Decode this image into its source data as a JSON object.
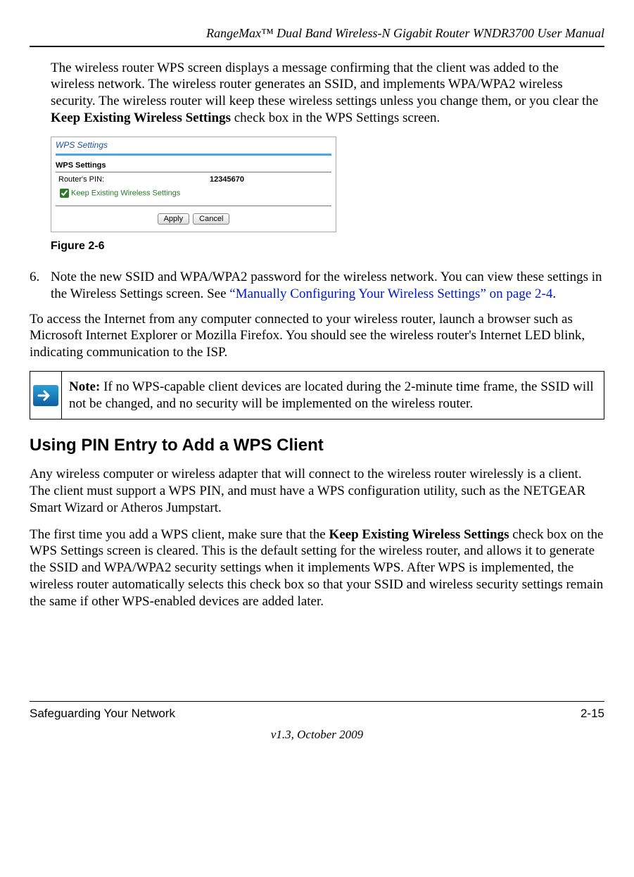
{
  "header": {
    "title": "RangeMax™ Dual Band Wireless-N Gigabit Router WNDR3700 User Manual"
  },
  "para1": {
    "pre": "The wireless router WPS screen displays a message confirming that the client was added to the wireless network. The wireless router generates an SSID, and implements WPA/WPA2 wireless security. The wireless router will keep these wireless settings unless you change them, or you clear the ",
    "bold": "Keep Existing Wireless Settings",
    "post": " check box in the WPS Settings screen."
  },
  "figure": {
    "title": "WPS Settings",
    "section_label": "WPS Settings",
    "pin_label": "Router's PIN:",
    "pin_value": "12345670",
    "checkbox_label": "Keep Existing Wireless Settings",
    "apply_label": "Apply",
    "cancel_label": "Cancel",
    "caption": "Figure 2-6"
  },
  "step6": {
    "num": "6.",
    "text_pre": "Note the new SSID and WPA/WPA2 password for the wireless network. You can view these settings in the Wireless Settings screen. See ",
    "link": "“Manually Configuring Your Wireless Settings” on page 2-4",
    "post": "."
  },
  "para_access": "To access the Internet from any computer connected to your wireless router, launch a browser such as Microsoft Internet Explorer or Mozilla Firefox. You should see the wireless router's Internet LED blink, indicating communication to the ISP.",
  "note": {
    "label": "Note:",
    "text": " If no WPS-capable client devices are located during the 2-minute time frame, the SSID will not be changed, and no security will be implemented on the wireless router."
  },
  "section_heading": "Using PIN Entry to Add a WPS Client",
  "para_pin1": "Any wireless computer or wireless adapter that will connect to the wireless router wirelessly is a client. The client must support a WPS PIN, and must have a WPS configuration utility, such as the NETGEAR Smart Wizard or Atheros Jumpstart.",
  "para_pin2": {
    "pre": "The first time you add a WPS client, make sure that the ",
    "bold": "Keep Existing Wireless Settings",
    "post": " check box on the WPS Settings screen is cleared. This is the default setting for the wireless router, and allows it to generate the SSID and WPA/WPA2 security settings when it implements WPS. After WPS is implemented, the wireless router automatically selects this check box so that your SSID and wireless security settings remain the same if other WPS-enabled devices are added later."
  },
  "footer": {
    "left": "Safeguarding Your Network",
    "right": "2-15",
    "version": "v1.3, October 2009"
  }
}
